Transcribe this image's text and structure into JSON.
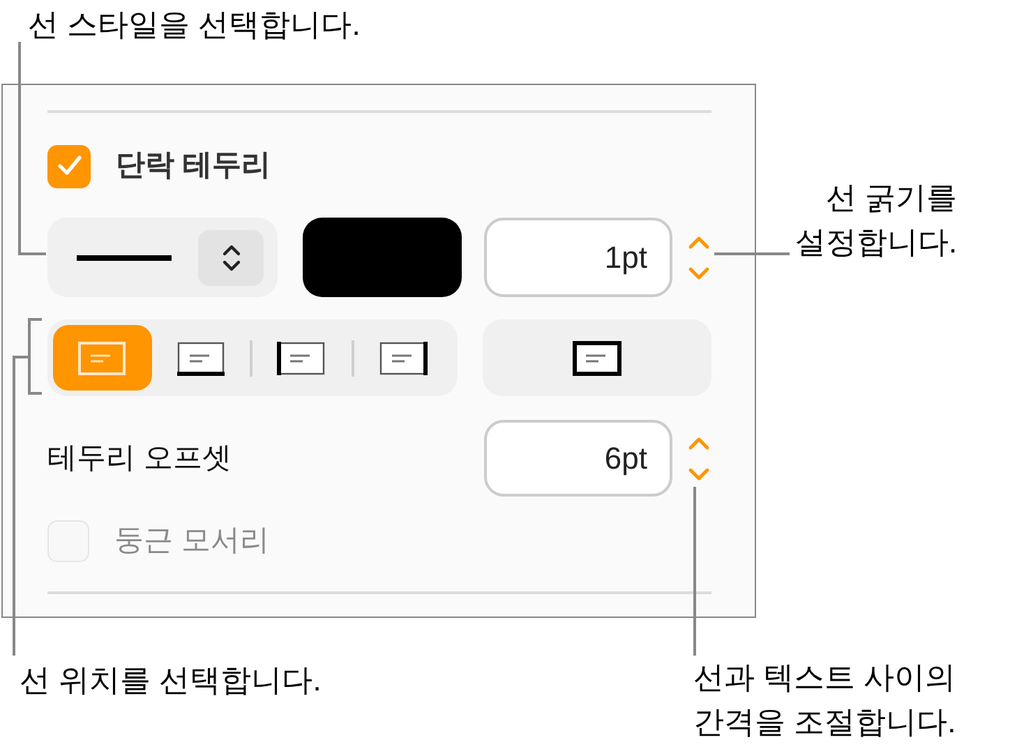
{
  "callouts": [
    {
      "text": "선 스타일을 선택합니다."
    },
    {
      "text": "선 굵기를\n설정합니다."
    },
    {
      "text": "선 위치를 선택합니다."
    },
    {
      "text": "선과 텍스트 사이의\n간격을 조절합니다."
    }
  ],
  "panel": {
    "border_checkbox": {
      "label": "단락 테두리",
      "checked": true
    },
    "width_field": {
      "value": "1pt"
    },
    "positions": [
      {
        "kind": "all",
        "selected": true
      },
      {
        "kind": "bottom",
        "selected": false
      },
      {
        "kind": "left",
        "selected": false
      },
      {
        "kind": "right",
        "selected": false
      }
    ],
    "outline_button": {
      "kind": "outline",
      "selected": false
    },
    "offset": {
      "label": "테두리 오프셋",
      "value": "6pt"
    },
    "rounded_checkbox": {
      "label": "둥근 모서리",
      "checked": false,
      "disabled": true
    }
  }
}
